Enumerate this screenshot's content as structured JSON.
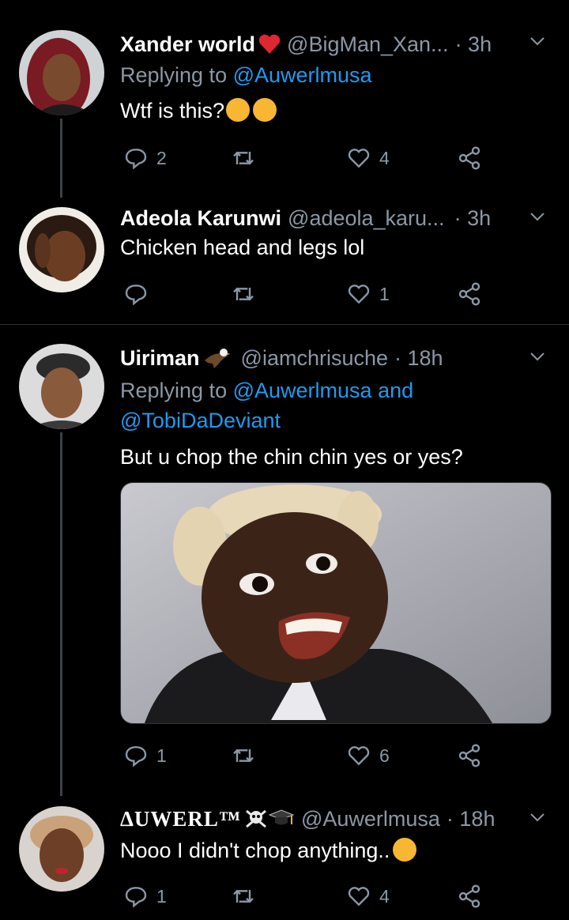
{
  "tweets": [
    {
      "name": "Xander world",
      "handle": "@BigMan_Xan...",
      "time": "· 3h",
      "replying_prefix": "Replying to",
      "replying_to": "@Auwerlmusa",
      "text": "Wtf is this?",
      "text_emojis": [
        "loudly-crying-face",
        "loudly-crying-face"
      ],
      "name_emoji": "red-heart",
      "replies": "2",
      "retweets": "",
      "likes": "4"
    },
    {
      "name": "Adeola Karunwi",
      "handle": "@adeola_karu...",
      "time": "· 3h",
      "text": "Chicken head and legs lol",
      "replies": "",
      "retweets": "",
      "likes": "1"
    },
    {
      "name": "Uiriman",
      "name_emoji": "eagle",
      "handle": "@iamchrisuche",
      "time": "· 18h",
      "replying_prefix": "Replying to",
      "replying_to": "@Auwerlmusa",
      "replying_and": "and",
      "replying_to_2": "@TobiDaDeviant",
      "text": "But u chop the chin chin yes or yes?",
      "media": "photo",
      "replies": "1",
      "retweets": "",
      "likes": "6"
    },
    {
      "name": "ΔUWERL™",
      "name_emoji": "skull-crossbones, graduation-cap",
      "handle": "@Auwerlmusa",
      "time": "· 18h",
      "text": "Nooo I didn't chop anything..",
      "text_emojis": [
        "smirking-face"
      ],
      "replies": "1",
      "retweets": "",
      "likes": "4"
    }
  ],
  "colors": {
    "background": "#000000",
    "text": "#ffffff",
    "muted": "#8b98a5",
    "link": "#1d9bf0",
    "divider": "#2f3336"
  }
}
